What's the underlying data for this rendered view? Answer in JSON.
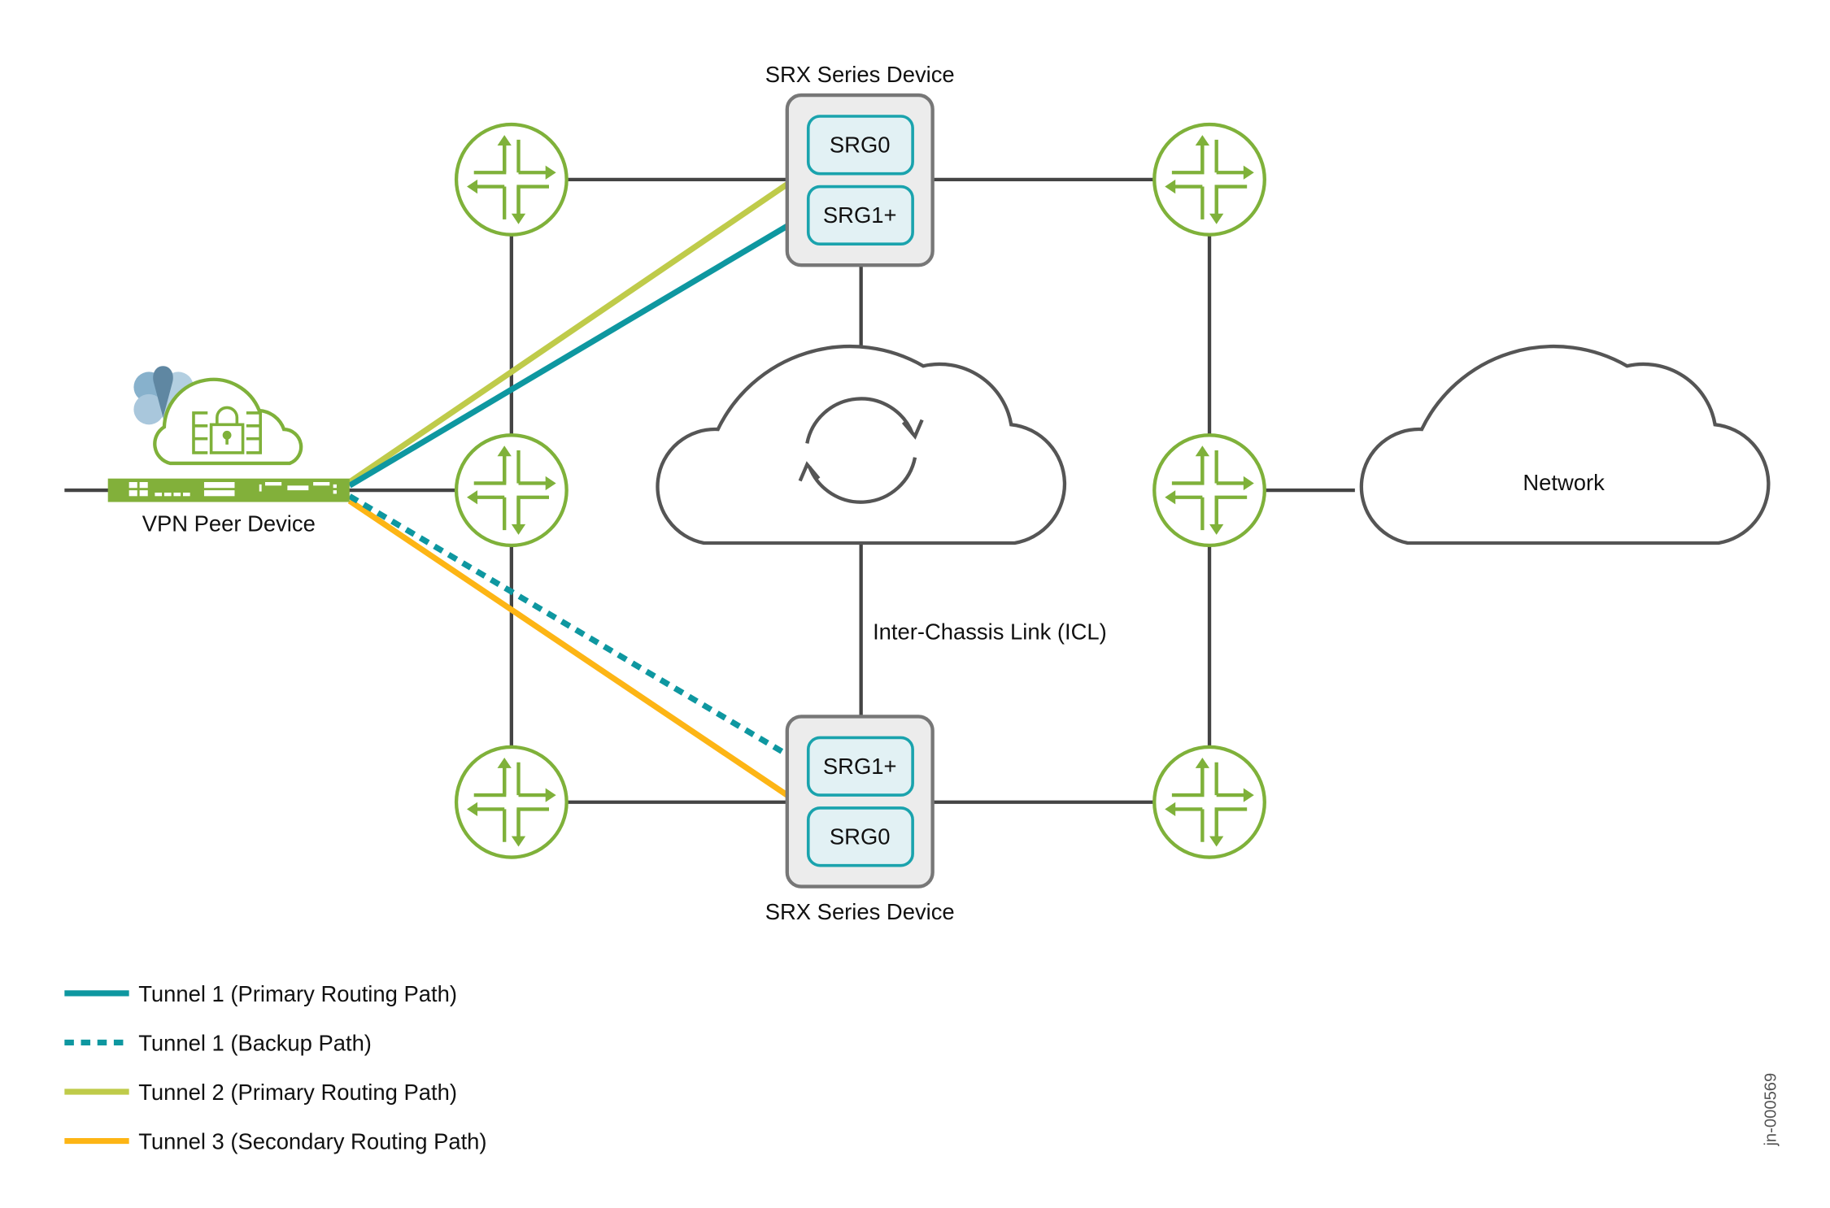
{
  "colors": {
    "router_green": "#7fb13a",
    "line_gray": "#444444",
    "tunnel1": "#0e97a0",
    "tunnel2": "#bfcb4a",
    "tunnel3": "#fdb515",
    "srg_fill": "#e2f1f4",
    "srx_fill": "#ececec"
  },
  "devices": {
    "srx_top": {
      "label": "SRX Series Device",
      "srg_a": "SRG0",
      "srg_b": "SRG1+"
    },
    "srx_bottom": {
      "label": "SRX Series Device",
      "srg_a": "SRG1+",
      "srg_b": "SRG0"
    },
    "vpn_peer": {
      "label": "VPN Peer Device"
    },
    "network_cloud": {
      "label": "Network"
    },
    "icl": {
      "label": "Inter-Chassis Link (ICL)"
    }
  },
  "legend": [
    {
      "label": "Tunnel 1 (Primary Routing Path)",
      "style": "solid",
      "color": "#0e97a0"
    },
    {
      "label": "Tunnel 1 (Backup Path)",
      "style": "dashed",
      "color": "#0e97a0"
    },
    {
      "label": "Tunnel 2 (Primary Routing Path)",
      "style": "solid",
      "color": "#bfcb4a"
    },
    {
      "label": "Tunnel 3 (Secondary Routing Path)",
      "style": "solid",
      "color": "#fdb515"
    }
  ],
  "figure_id": "jn-000569"
}
